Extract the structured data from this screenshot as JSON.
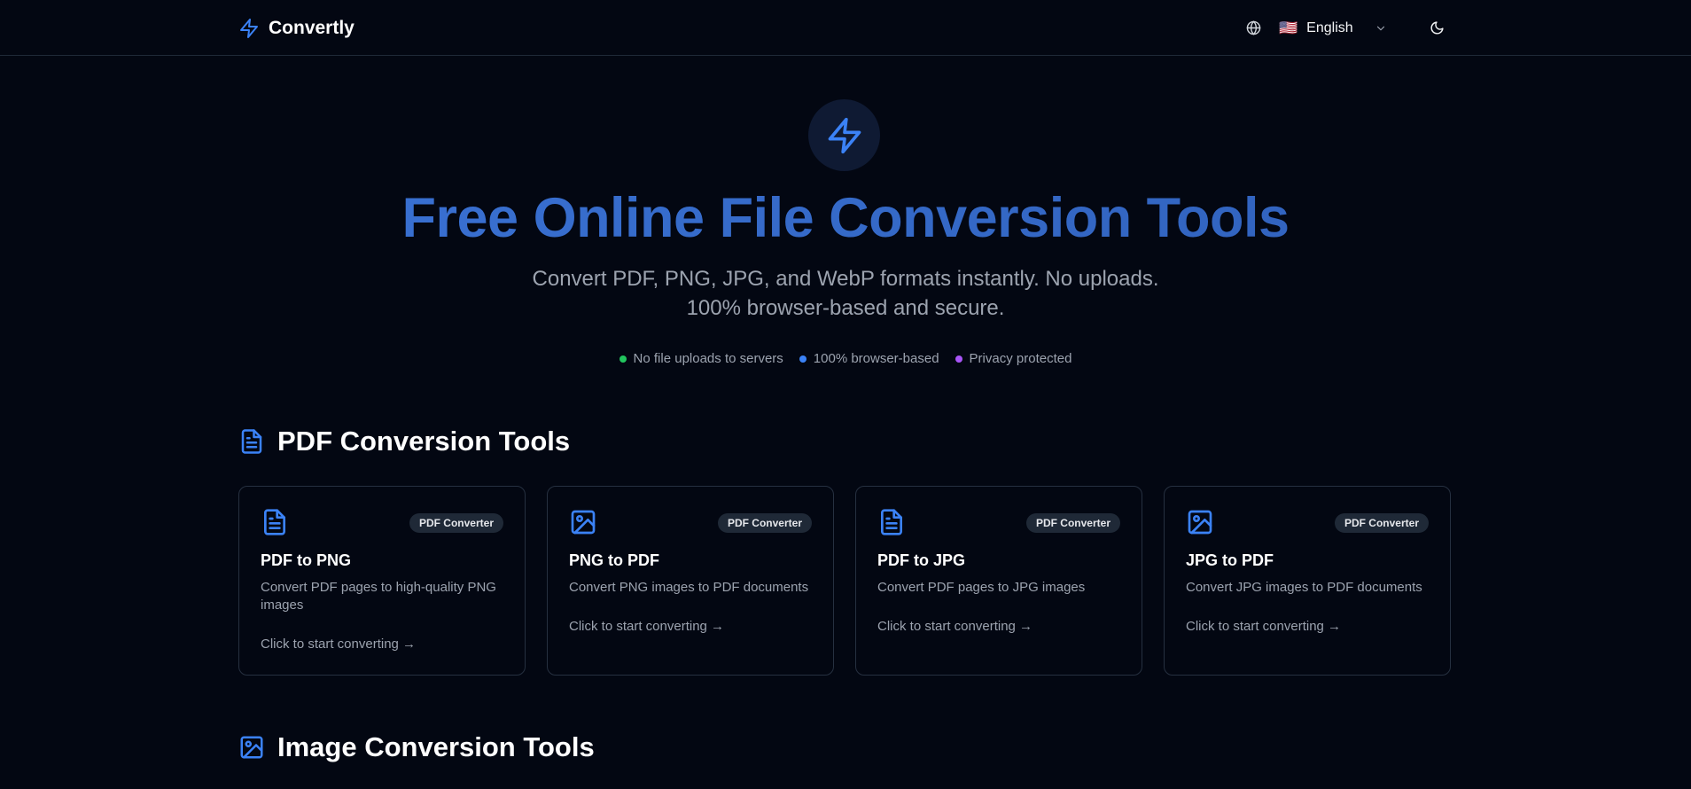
{
  "header": {
    "brand": "Convertly",
    "language": {
      "flag": "🇺🇸",
      "label": "English"
    }
  },
  "hero": {
    "title": "Free Online File Conversion Tools",
    "subtitle_line1": "Convert PDF, PNG, JPG, and WebP formats instantly. No uploads.",
    "subtitle_line2": "100% browser-based and secure.",
    "features": [
      {
        "label": "No file uploads to servers",
        "color": "#22c55e"
      },
      {
        "label": "100% browser-based",
        "color": "#3b82f6"
      },
      {
        "label": "Privacy protected",
        "color": "#a855f7"
      }
    ]
  },
  "sections": {
    "pdf": {
      "title": "PDF Conversion Tools",
      "icon": "file-text-icon"
    },
    "image": {
      "title": "Image Conversion Tools",
      "icon": "image-icon"
    }
  },
  "cards": [
    {
      "title": "PDF to PNG",
      "badge": "PDF Converter",
      "description": "Convert PDF pages to high-quality PNG images",
      "cta": "Click to start converting →",
      "icon": "file-text-icon"
    },
    {
      "title": "PNG to PDF",
      "badge": "PDF Converter",
      "description": "Convert PNG images to PDF documents",
      "cta": "Click to start converting →",
      "icon": "image-icon"
    },
    {
      "title": "PDF to JPG",
      "badge": "PDF Converter",
      "description": "Convert PDF pages to JPG images",
      "cta": "Click to start converting →",
      "icon": "file-text-icon"
    },
    {
      "title": "JPG to PDF",
      "badge": "PDF Converter",
      "description": "Convert JPG images to PDF documents",
      "cta": "Click to start converting →",
      "icon": "image-icon"
    }
  ],
  "colors": {
    "accent": "#3b82f6",
    "background": "#030712",
    "title_gradient_start": "#3b74d8",
    "title_gradient_end": "#2f5fb8"
  }
}
